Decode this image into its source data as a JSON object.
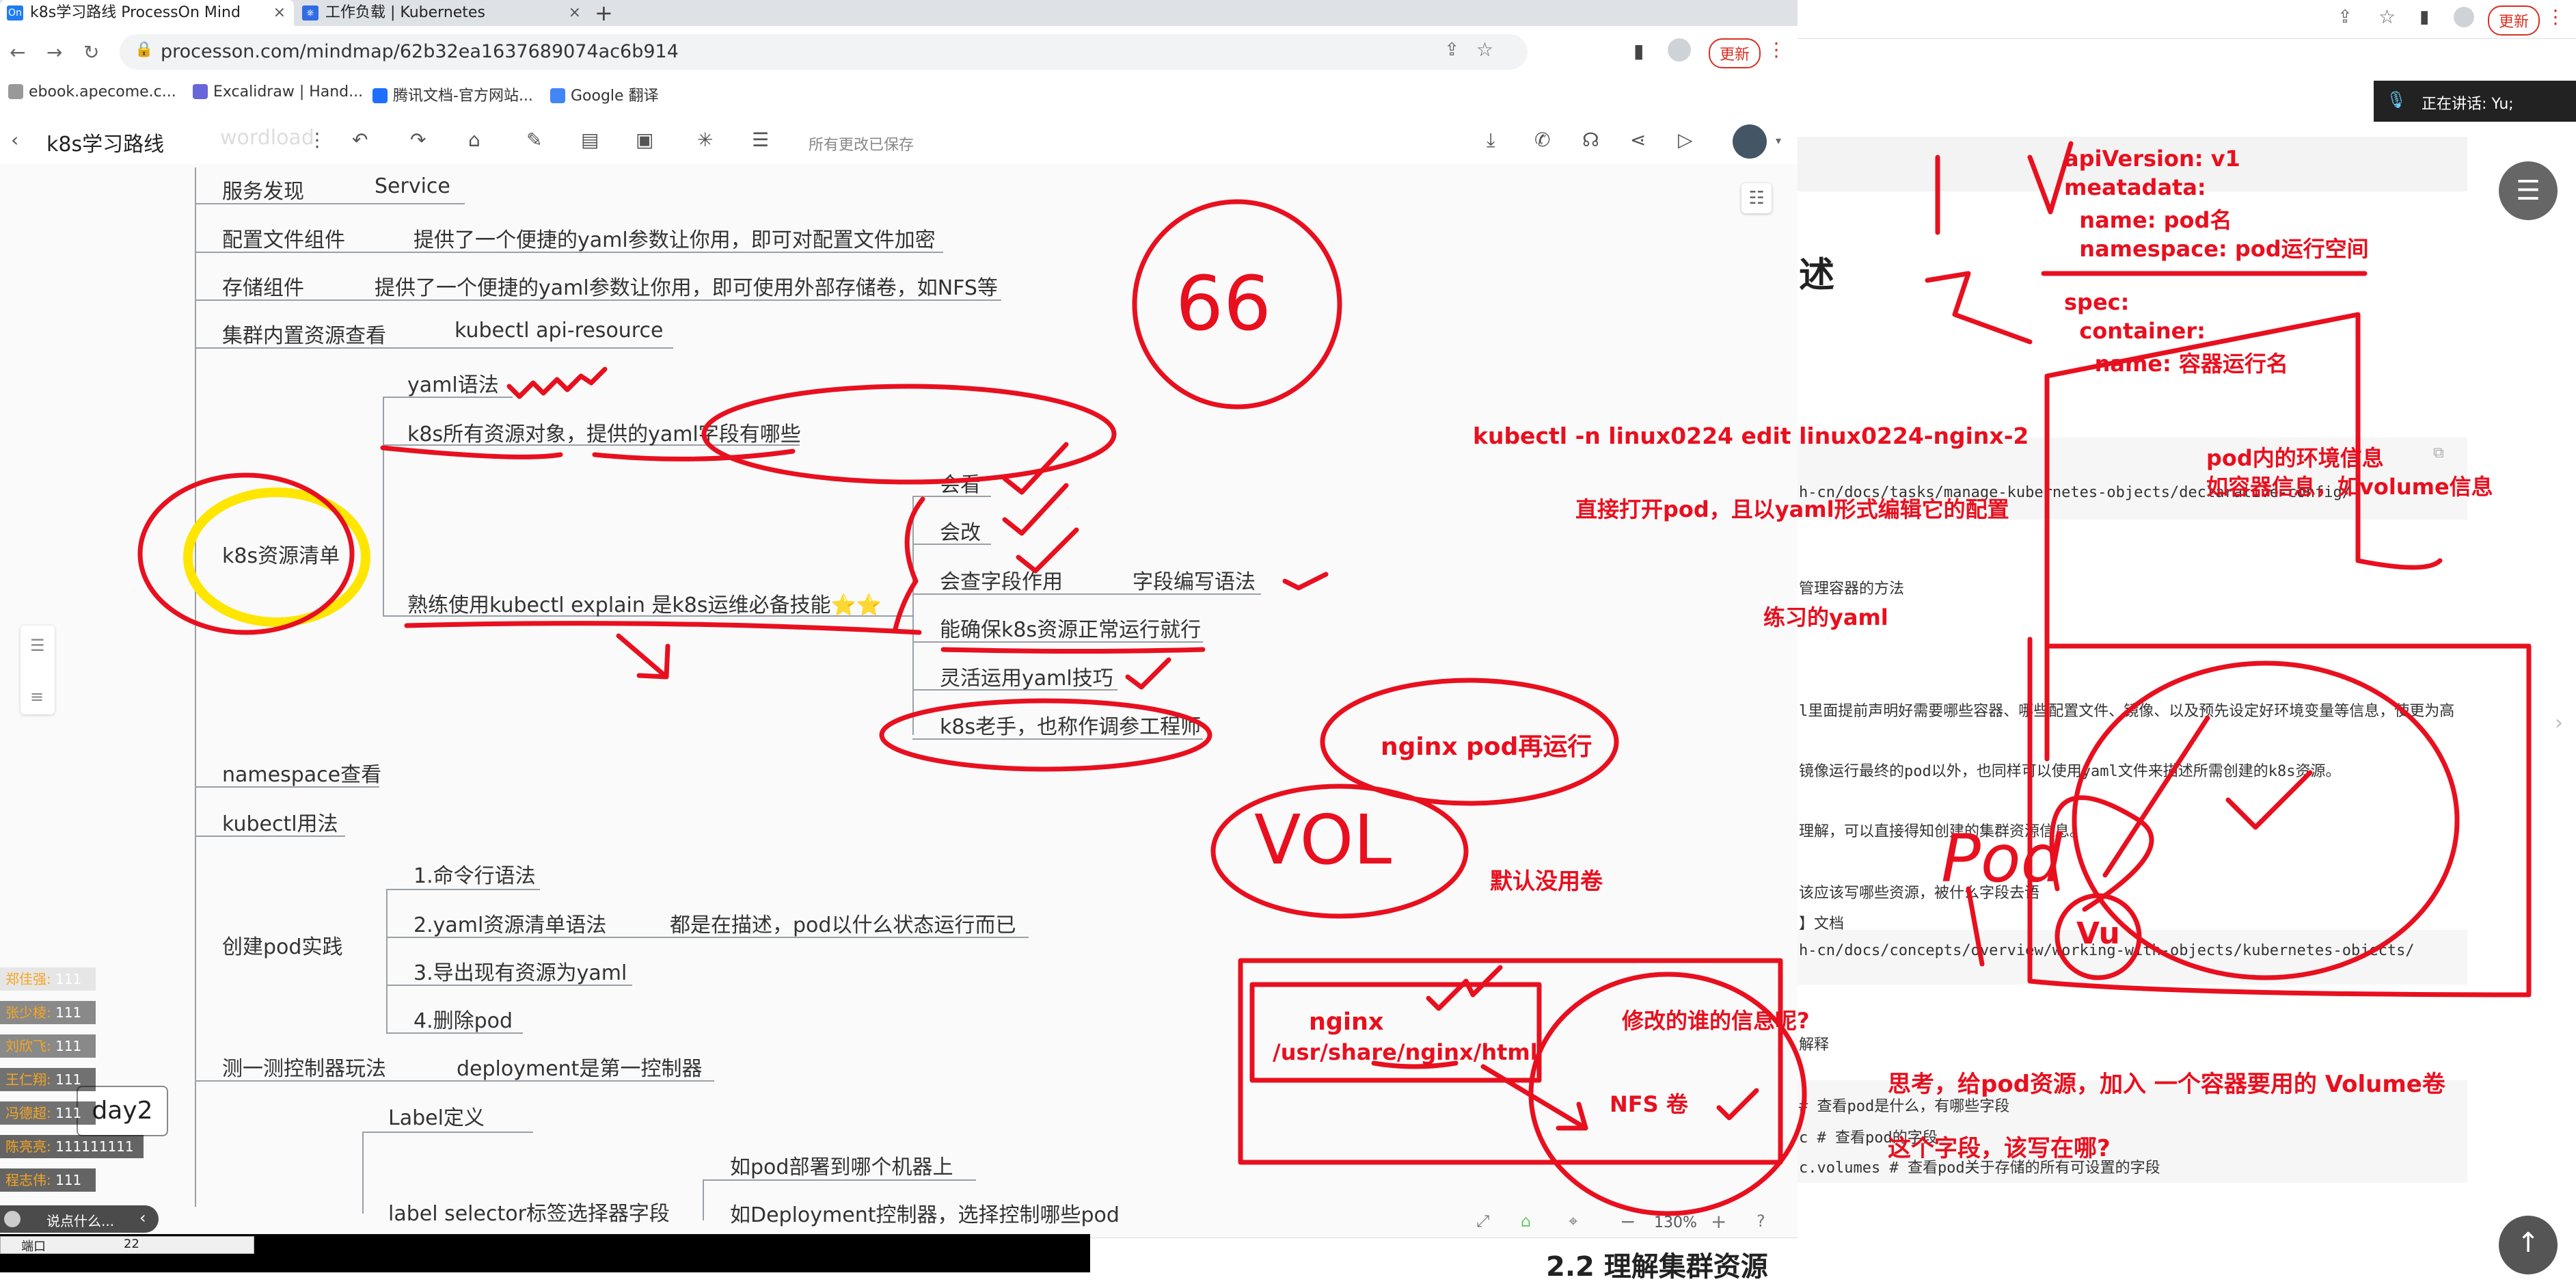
{
  "browser": {
    "tabs": [
      {
        "label": "k8s学习路线 ProcessOn Mind",
        "favicon": "On",
        "active": true
      },
      {
        "label": "工作负载 | Kubernetes",
        "favicon": "⎈",
        "active": false
      }
    ],
    "url": "processon.com/mindmap/62b32ea1637689074ac6b914",
    "update_label": "更新",
    "bookmarks": [
      "ebook.apecome.c...",
      "Excalidraw | Hand...",
      "腾讯文档-官方网站...",
      "Google 翻译"
    ]
  },
  "app": {
    "title": "k8s学习路线",
    "save_status": "所有更改已保存",
    "zoom": "130%",
    "faded_top_text": "wordload"
  },
  "mindmap": {
    "root": "day2",
    "nodes": [
      {
        "text": "服务发现"
      },
      {
        "text": "Service"
      },
      {
        "text": "配置文件组件"
      },
      {
        "text": "提供了一个便捷的yaml参数让你用，即可对配置文件加密"
      },
      {
        "text": "存储组件"
      },
      {
        "text": "提供了一个便捷的yaml参数让你用，即可使用外部存储卷，如NFS等"
      },
      {
        "text": "集群内置资源查看"
      },
      {
        "text": "kubectl api-resource"
      },
      {
        "text": "yaml语法"
      },
      {
        "text": "k8s所有资源对象，提供的yaml字段有哪些"
      },
      {
        "text": "k8s资源清单"
      },
      {
        "text": "熟练使用kubectl explain 是k8s运维必备技能⭐⭐"
      },
      {
        "text": "会看"
      },
      {
        "text": "会改"
      },
      {
        "text": "会查字段作用"
      },
      {
        "text": "字段编写语法"
      },
      {
        "text": "能确保k8s资源正常运行就行"
      },
      {
        "text": "灵活运用yaml技巧"
      },
      {
        "text": "k8s老手，也称作调参工程师"
      },
      {
        "text": "namespace查看"
      },
      {
        "text": "kubectl用法"
      },
      {
        "text": "创建pod实践"
      },
      {
        "text": "1.命令行语法"
      },
      {
        "text": "2.yaml资源清单语法"
      },
      {
        "text": "都是在描述，pod以什么状态运行而已"
      },
      {
        "text": "3.导出现有资源为yaml"
      },
      {
        "text": "4.删除pod"
      },
      {
        "text": "测一测控制器玩法"
      },
      {
        "text": "deployment是第一控制器"
      },
      {
        "text": "Label定义"
      },
      {
        "text": "如pod部署到哪个机器上"
      },
      {
        "text": "label selector标签选择器字段"
      },
      {
        "text": "如Deployment控制器，选择控制哪些pod"
      }
    ]
  },
  "annotations": {
    "cmd": "kubectl  -n  linux0224   edit   linux0224-nginx-2",
    "cmd_desc": "直接打开pod，且以yaml形式编辑它的配置",
    "practice": "练习的yaml",
    "nginx_rerun": "nginx pod再运行",
    "vol": "VOL",
    "default_no_vol": "默认没用卷",
    "nginx": "nginx",
    "nginx_path": "/usr/share/nginx/html",
    "modify_q": "修改的谁的信息呢?",
    "nfs": "NFS 卷",
    "think": "思考，给pod资源，加入 一个容器要用的 Volume卷",
    "where": "这个字段，该写在哪?",
    "yaml_lines": [
      "apiVersion: v1",
      "meatadata:",
      "  name: pod名",
      "  namespace: pod运行空间",
      "spec:",
      "  container:",
      "    name: 容器运行名"
    ],
    "pod_env": "pod内的环境信息",
    "pod_env2": "如容器信息，如volume信息",
    "big66": "66",
    "pod_label": "Pod",
    "vu": "Vu"
  },
  "chat": {
    "placeholder": "说点什么...",
    "messages": [
      {
        "user": "郑佳强:",
        "text": "111"
      },
      {
        "user": "张少棱:",
        "text": "111"
      },
      {
        "user": "刘欣飞:",
        "text": "111"
      },
      {
        "user": "王仁翔:",
        "text": "111"
      },
      {
        "user": "冯德超:",
        "text": "111"
      },
      {
        "user": "陈亮亮:",
        "text": "111111111"
      },
      {
        "user": "程志伟:",
        "text": "111"
      }
    ]
  },
  "terminal": {
    "port_label": "端口",
    "port_value": "22"
  },
  "rightpage": {
    "speaking": "正在讲话: Yu;",
    "update_label": "更新",
    "heading_char": "述",
    "mono_lines": [
      "h-cn/docs/tasks/manage-kubernetes-objects/declarative-config/",
      "管理容器的方法",
      "l里面提前声明好需要哪些容器、哪些配置文件、镜像、以及预先设定好环境变量等信息，使更为高",
      "镜像运行最终的pod以外，也同样可以使用yaml文件来描述所需创建的k8s资源。",
      "理解，可以直接得知创建的集群资源信息。",
      "该应该写哪些资源，被什么字段去语",
      "】文档",
      "h-cn/docs/concepts/overview/working-with-objects/kubernetes-objects/",
      "解释",
      "# 查看pod是什么，有哪些字段",
      "c   # 查看pod的字段",
      "c.volumes # 查看pod关于存储的所有可设置的字段"
    ],
    "section_title": "2.2 理解集群资源"
  },
  "colors": {
    "annotation_red": "#e8101f",
    "highlight_yellow": "#ffe600",
    "line_gray": "#9aa0a6"
  }
}
